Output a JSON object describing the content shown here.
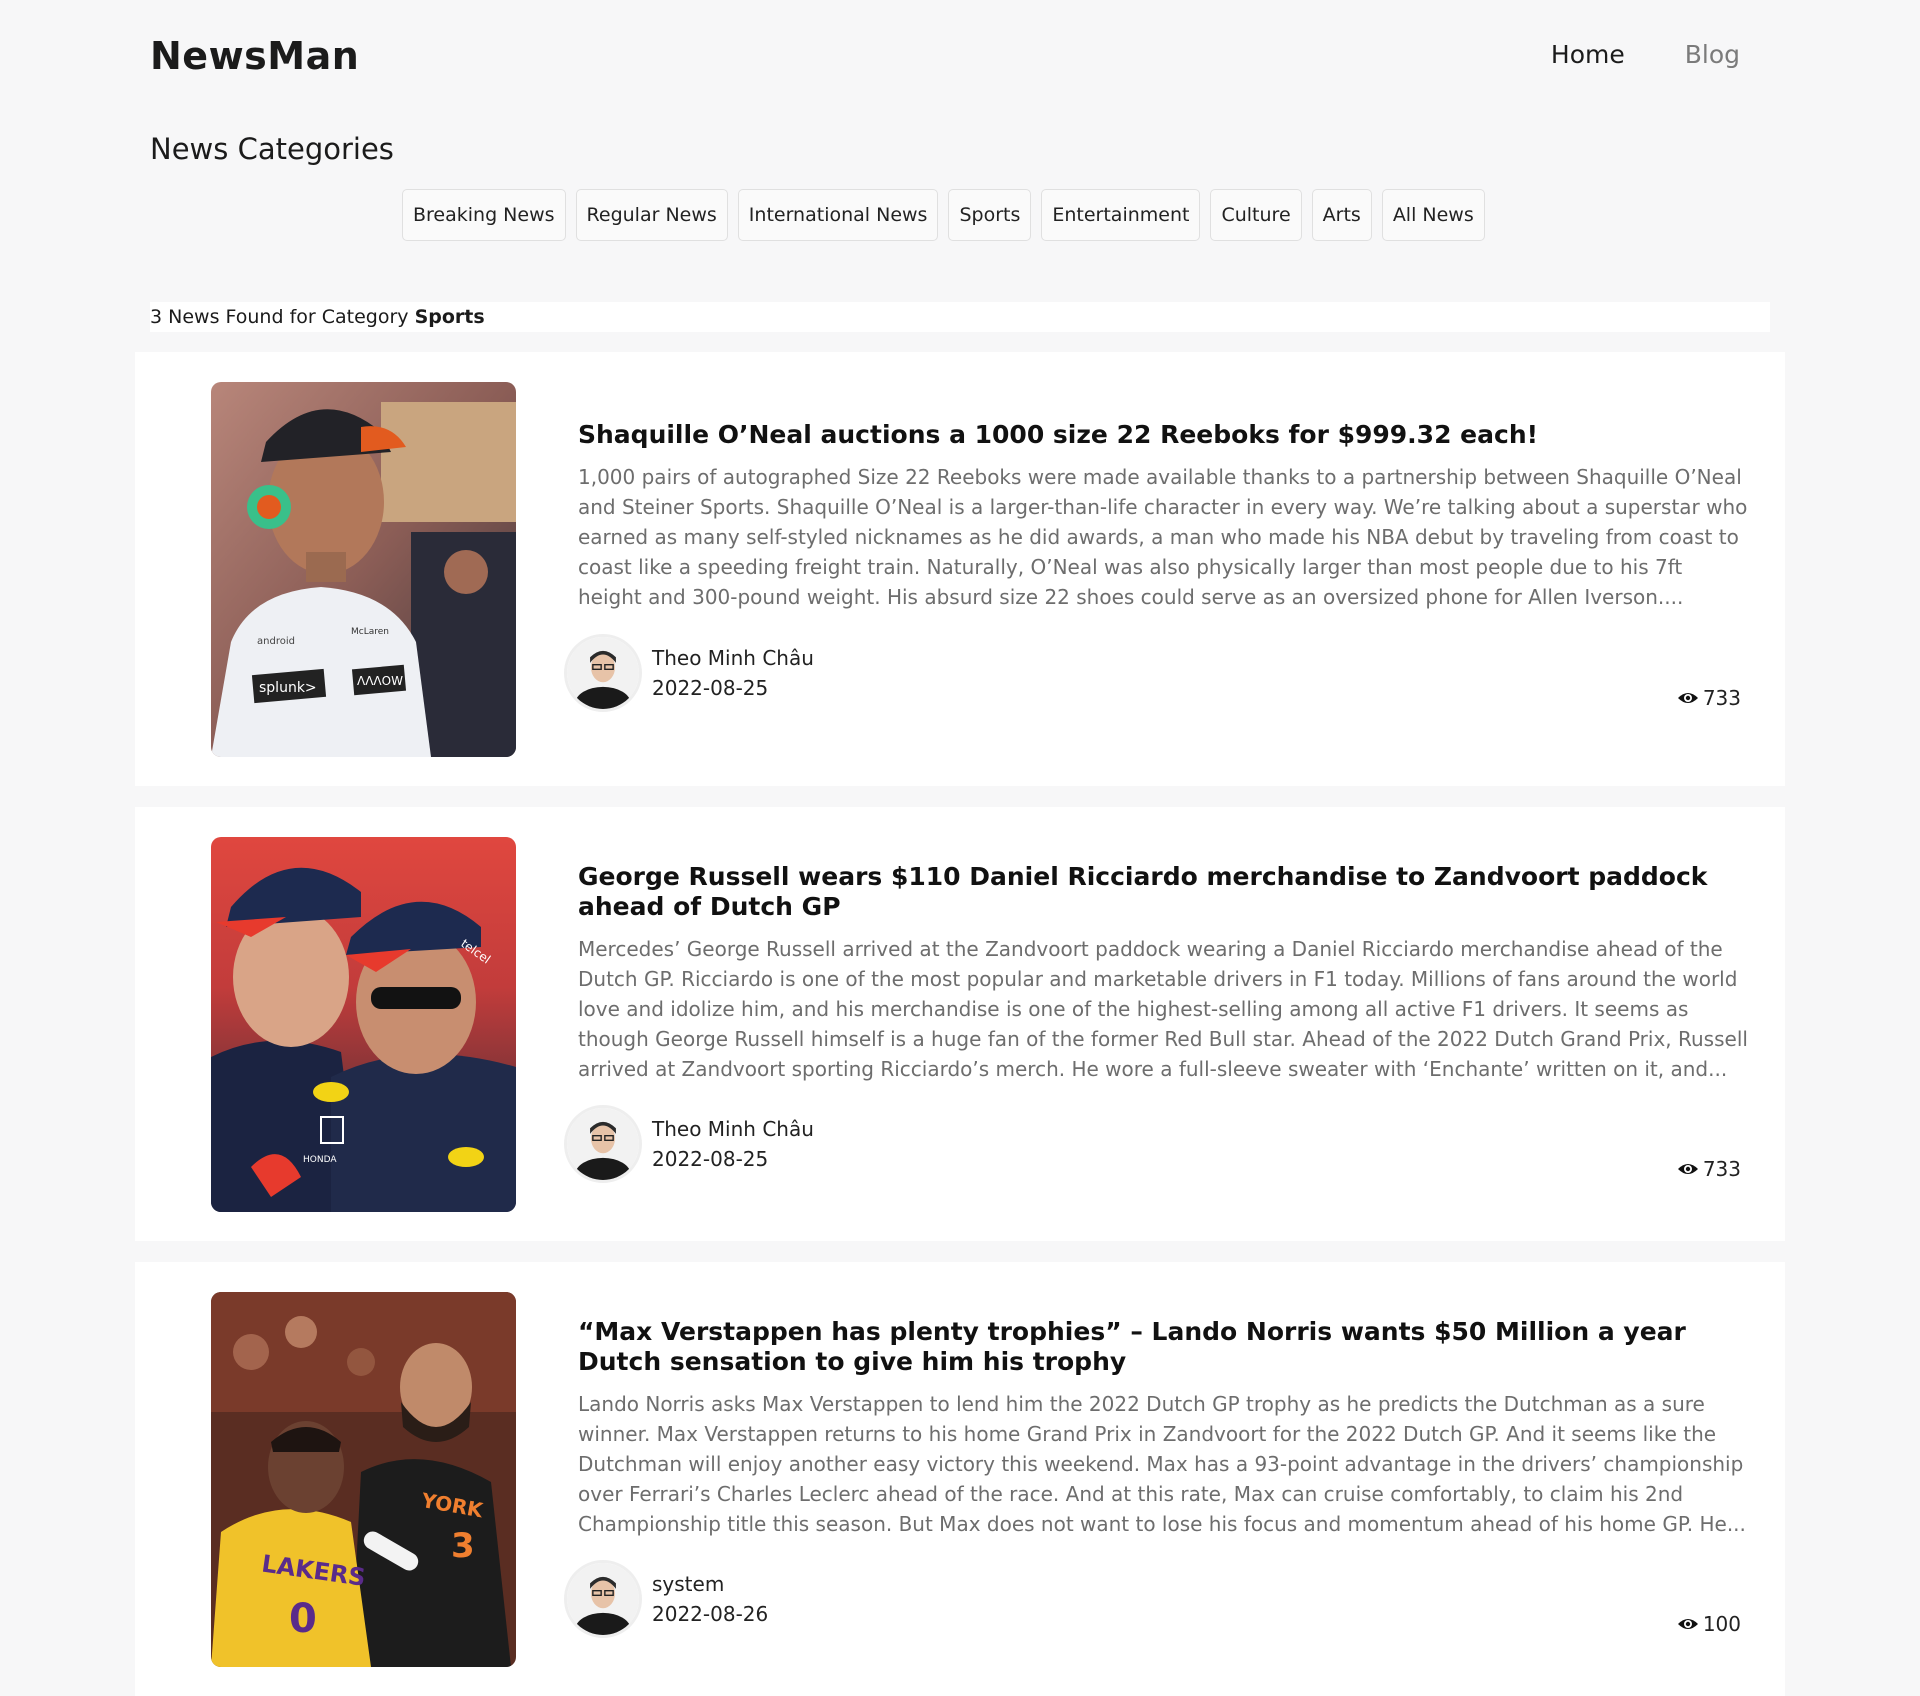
{
  "header": {
    "brand": "NewsMan",
    "nav": {
      "home": "Home",
      "blog": "Blog"
    }
  },
  "categories": {
    "heading": "News Categories",
    "items": [
      "Breaking News",
      "Regular News",
      "International News",
      "Sports",
      "Entertainment",
      "Culture",
      "Arts",
      "All News"
    ]
  },
  "results": {
    "prefix": "3 News Found for Category",
    "category": "Sports"
  },
  "colors": {
    "background": "#f7f7f8",
    "card": "#ffffff",
    "excerpt": "#6d6d6d",
    "nav_muted": "#7b7b7b"
  },
  "articles": [
    {
      "title": "Shaquille O’Neal auctions a 1000 size 22 Reeboks for $999.32 each!",
      "excerpt": "1,000 pairs of autographed Size 22 Reeboks were made available thanks to a partnership between Shaquille O’Neal and Steiner Sports. Shaquille O’Neal is a larger-than-life character in every way. We’re talking about a superstar who earned as many self-styled nicknames as he did awards, a man who made his NBA debut by traveling from coast to coast like a speeding freight train. Naturally, O’Neal was also physically larger than most people due to his 7ft height and 300-pound weight. His absurd size 22 shoes could serve as an oversized phone for Allen Iverson....",
      "author": "Theo Minh Châu",
      "date": "2022-08-25",
      "views": "733",
      "image": "racing-driver-photo",
      "image_text": [
        "splunk>",
        "ΛΛΛOW",
        "android",
        "McLaren"
      ]
    },
    {
      "title": "George Russell wears $110 Daniel Ricciardo merchandise to Zandvoort paddock ahead of Dutch GP",
      "excerpt": "Mercedes’ George Russell arrived at the Zandvoort paddock wearing a Daniel Ricciardo merchandise ahead of the Dutch GP. Ricciardo is one of the most popular and marketable drivers in F1 today. Millions of fans around the world love and idolize him, and his merchandise is one of the highest-selling among all active F1 drivers. It seems as though George Russell himself is a huge fan of the former Red Bull star. Ahead of the 2022 Dutch Grand Prix, Russell arrived at Zandvoort sporting Ricciardo’s merch. He wore a full-sleeve sweater with ‘Enchante’ written on it, and...",
      "author": "Theo Minh Châu",
      "date": "2022-08-25",
      "views": "733",
      "image": "red-bull-drivers-photo",
      "image_text": [
        "HONDA",
        "telcel"
      ]
    },
    {
      "title": "“Max Verstappen has plenty trophies” – Lando Norris wants $50 Million a year Dutch sensation to give him his trophy",
      "excerpt": "Lando Norris asks Max Verstappen to lend him the 2022 Dutch GP trophy as he predicts the Dutchman as a sure winner. Max Verstappen returns to his home Grand Prix in Zandvoort for the 2022 Dutch GP. And it seems like the Dutchman will enjoy another easy victory this weekend. Max has a 93-point advantage in the drivers’ championship over Ferrari’s Charles Leclerc ahead of the race. And at this rate, Max can cruise comfortably, to claim his 2nd Championship title this season. But Max does not want to lose his focus and momentum ahead of his home GP. He...",
      "author": "system",
      "date": "2022-08-26",
      "views": "100",
      "image": "basketball-players-photo",
      "image_text": [
        "LAKERS",
        "0",
        "YORK",
        "3"
      ]
    }
  ]
}
